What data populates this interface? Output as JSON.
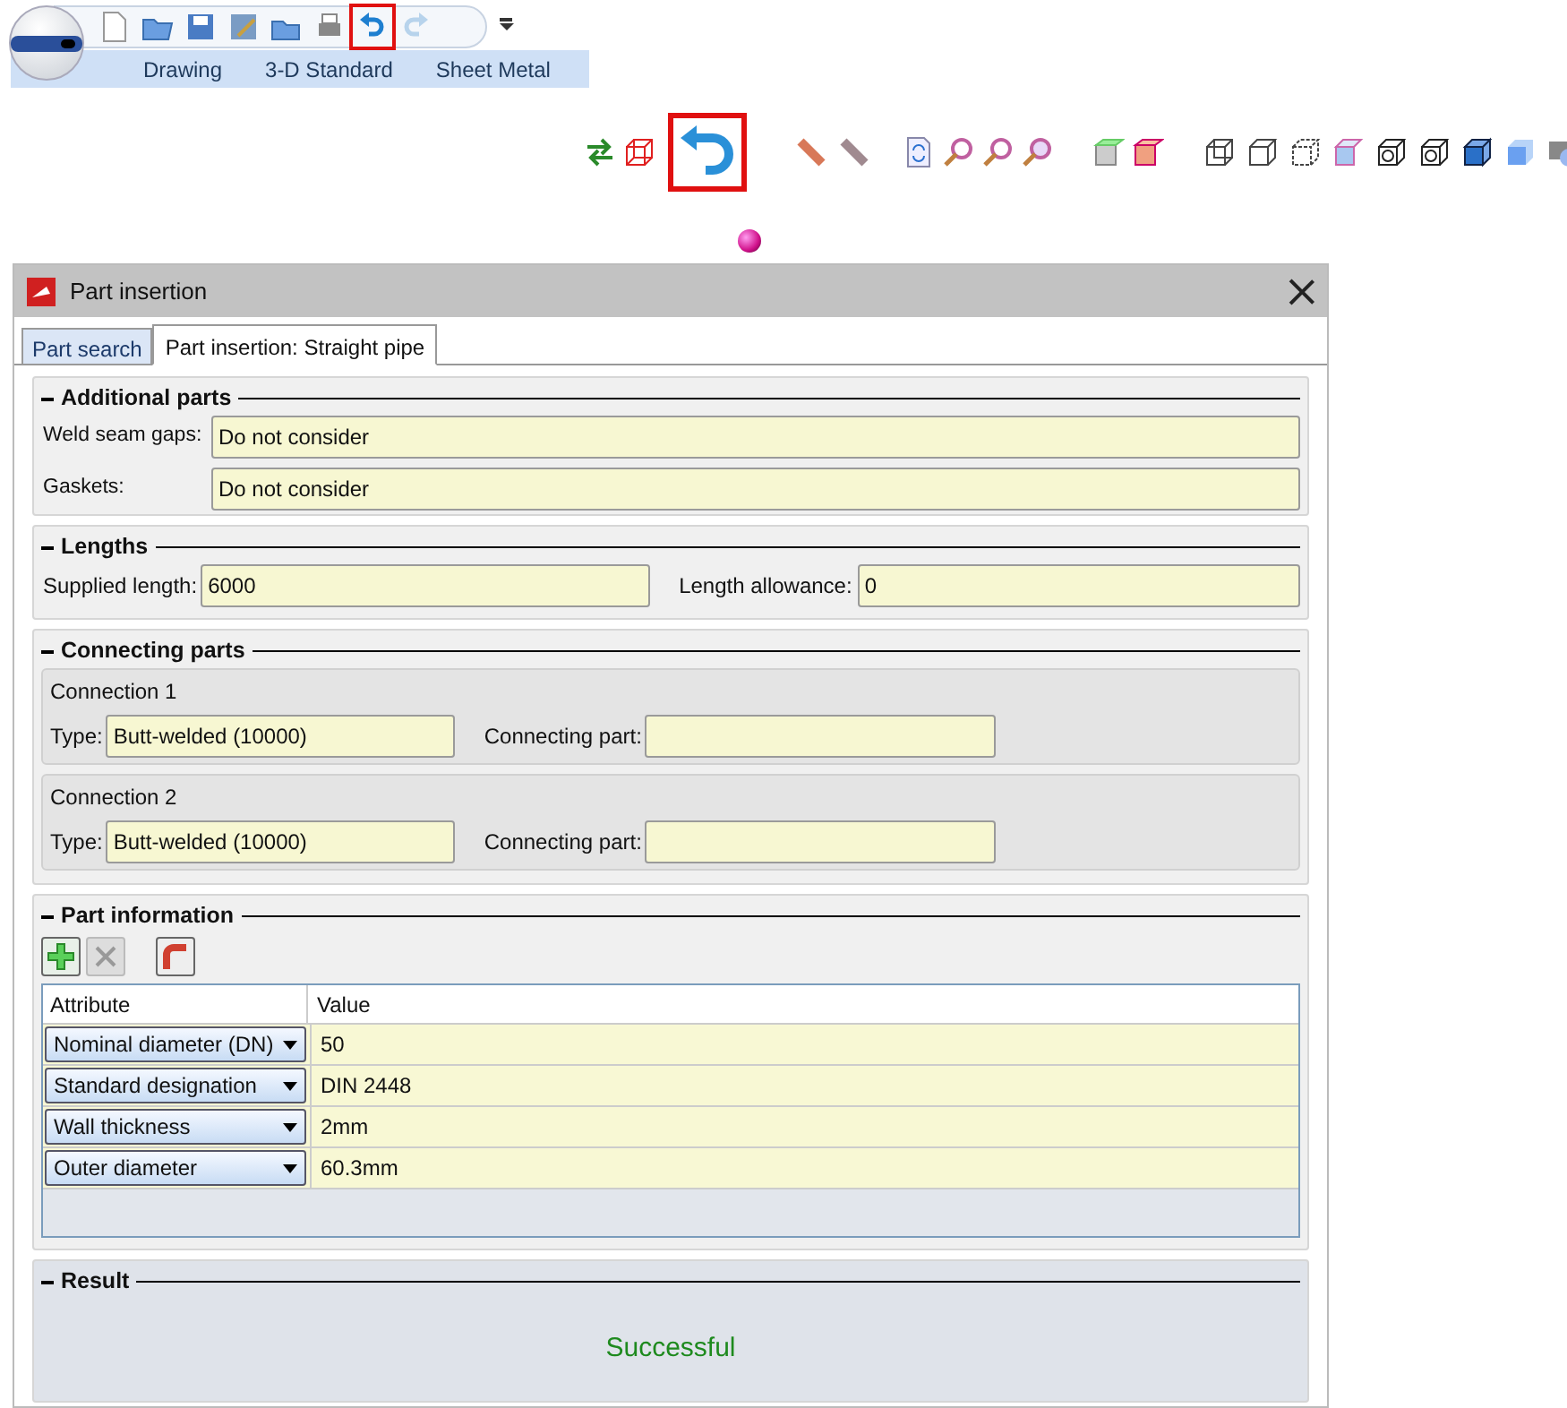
{
  "ribbon": {
    "tabs": [
      {
        "label": "Drawing",
        "selected": false
      },
      {
        "label": "3-D Standard",
        "selected": false
      },
      {
        "label": "Sheet Metal",
        "selected": false
      }
    ]
  },
  "dialog": {
    "title": "Part insertion",
    "tabs": [
      {
        "label": "Part search",
        "selected": false
      },
      {
        "label": "Part insertion: Straight pipe",
        "selected": true
      }
    ],
    "additional_parts": {
      "title": "Additional parts",
      "expanded": true,
      "fields": [
        {
          "label": "Weld seam gaps:",
          "value": "Do not consider"
        },
        {
          "label": "Gaskets:",
          "value": "Do not consider"
        }
      ]
    },
    "lengths": {
      "title": "Lengths",
      "expanded": true,
      "fields": [
        {
          "label": "Supplied length:",
          "value": "6000"
        },
        {
          "label": "Length allowance:",
          "value": "0"
        }
      ]
    },
    "connecting_parts": {
      "title": "Connecting parts",
      "expanded": true,
      "connections": [
        {
          "title": "Connection 1",
          "type_label": "Type:",
          "type": "Butt-welded (10000)",
          "part_label": "Connecting part:"
        },
        {
          "title": "Connection 2",
          "type_label": "Type:",
          "type": "Butt-welded (10000)",
          "part_label": "Connecting part:"
        }
      ]
    },
    "part_information": {
      "title": "Part information",
      "expanded": true,
      "columns": [
        "Attribute",
        "Value"
      ],
      "rows": [
        {
          "attribute": "Nominal diameter (DN)",
          "value": "50"
        },
        {
          "attribute": "Standard designation",
          "value": "DIN 2448"
        },
        {
          "attribute": "Wall thickness",
          "value": "2mm"
        },
        {
          "attribute": "Outer diameter",
          "value": "60.3mm"
        }
      ]
    },
    "result": {
      "title": "Result",
      "expanded": true,
      "message": "Successful"
    }
  }
}
